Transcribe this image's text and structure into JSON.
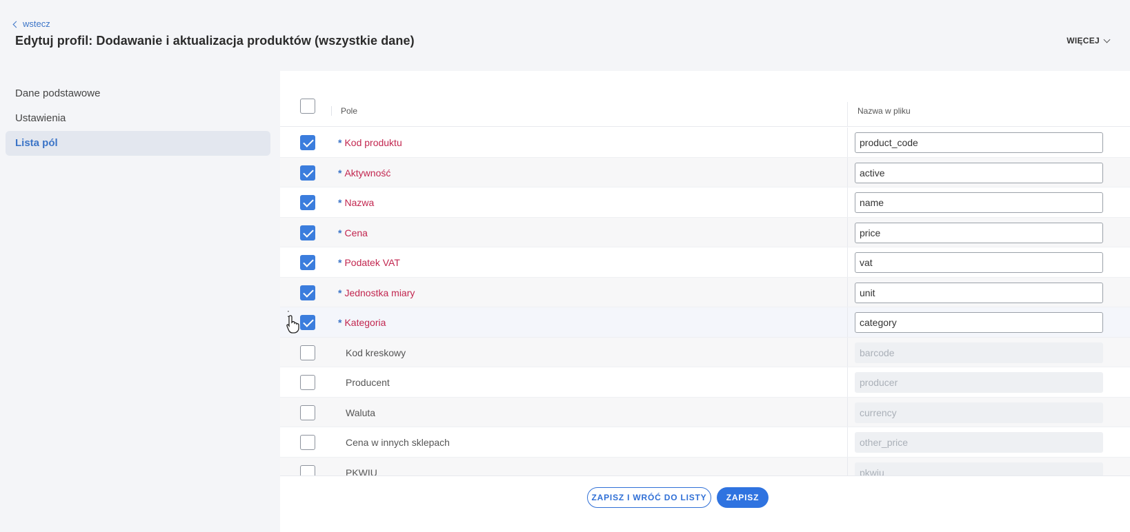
{
  "header": {
    "back_label": "wstecz",
    "title": "Edytuj profil: Dodawanie i aktualizacja produktów (wszystkie dane)",
    "more_label": "WIĘCEJ"
  },
  "sidebar": {
    "items": [
      {
        "label": "Dane podstawowe"
      },
      {
        "label": "Ustawienia"
      },
      {
        "label": "Lista pól"
      }
    ]
  },
  "table": {
    "col_field": "Pole",
    "col_filename": "Nazwa w pliku",
    "rows": [
      {
        "label": "Kod produktu",
        "value": "product_code",
        "checked": true,
        "required": true
      },
      {
        "label": "Aktywność",
        "value": "active",
        "checked": true,
        "required": true
      },
      {
        "label": "Nazwa",
        "value": "name",
        "checked": true,
        "required": true
      },
      {
        "label": "Cena",
        "value": "price",
        "checked": true,
        "required": true
      },
      {
        "label": "Podatek VAT",
        "value": "vat",
        "checked": true,
        "required": true
      },
      {
        "label": "Jednostka miary",
        "value": "unit",
        "checked": true,
        "required": true
      },
      {
        "label": "Kategoria",
        "value": "category",
        "checked": true,
        "required": true
      },
      {
        "label": "Kod kreskowy",
        "value": "barcode",
        "checked": false,
        "required": false
      },
      {
        "label": "Producent",
        "value": "producer",
        "checked": false,
        "required": false
      },
      {
        "label": "Waluta",
        "value": "currency",
        "checked": false,
        "required": false
      },
      {
        "label": "Cena w innych sklepach",
        "value": "other_price",
        "checked": false,
        "required": false
      },
      {
        "label": "PKWIU",
        "value": "pkwiu",
        "checked": false,
        "required": false
      }
    ]
  },
  "required_marker": "*",
  "footer": {
    "save_return_label": "ZAPISZ I WRÓĆ DO LISTY",
    "save_label": "ZAPISZ"
  }
}
